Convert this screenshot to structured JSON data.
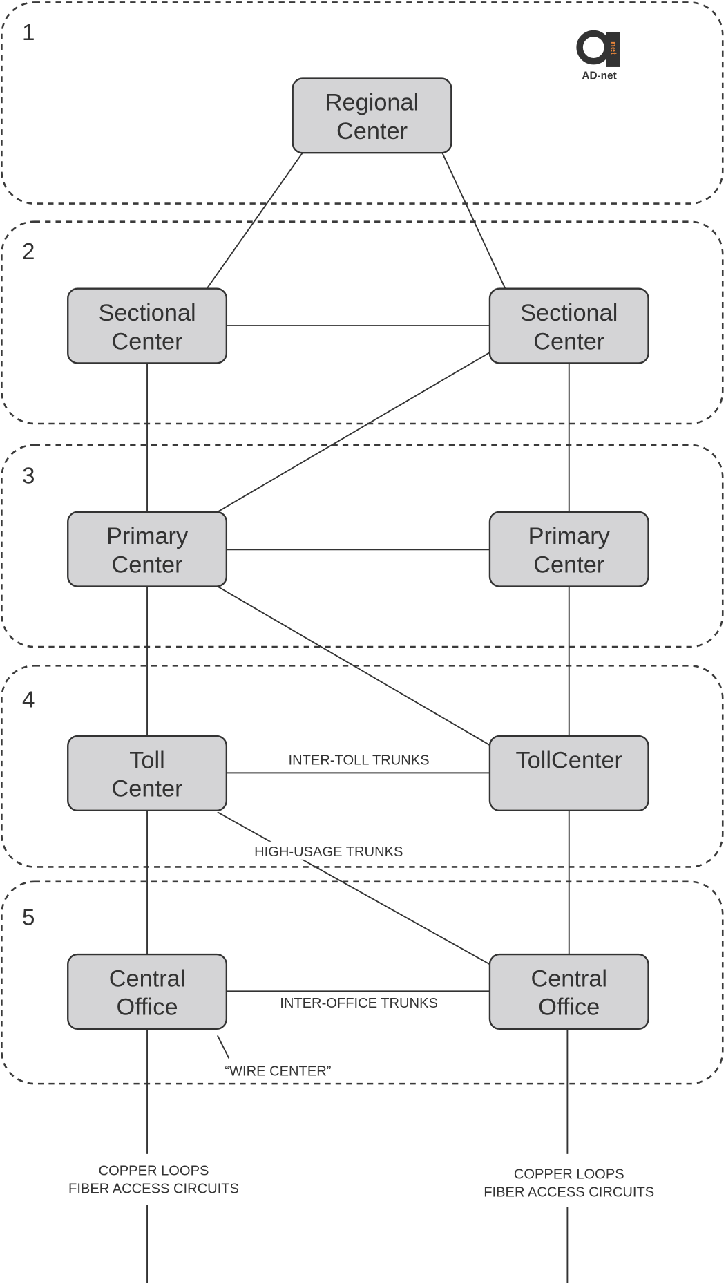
{
  "logo": {
    "text": "AD-net",
    "inner": "net",
    "accent": "#e8853a"
  },
  "levels": [
    "1",
    "2",
    "3",
    "4",
    "5"
  ],
  "nodes": {
    "regional": [
      "Regional",
      "Center"
    ],
    "sectional_left": [
      "Sectional",
      "Center"
    ],
    "sectional_right": [
      "Sectional",
      "Center"
    ],
    "primary_left": [
      "Primary",
      "Center"
    ],
    "primary_right": [
      "Primary",
      "Center"
    ],
    "toll_left": [
      "Toll",
      "Center"
    ],
    "toll_right": [
      "TollCenter"
    ],
    "central_left": [
      "Central",
      "Office"
    ],
    "central_right": [
      "Central",
      "Office"
    ]
  },
  "labels": {
    "inter_toll": "INTER-TOLL TRUNKS",
    "high_usage": "HIGH-USAGE TRUNKS",
    "inter_office": "INTER-OFFICE TRUNKS",
    "wire_center": "“WIRE CENTER”",
    "access_left": [
      "COPPER LOOPS",
      "FIBER ACCESS CIRCUITS"
    ],
    "access_right": [
      "COPPER LOOPS",
      "FIBER ACCESS CIRCUITS"
    ]
  },
  "colors": {
    "node_fill": "#d4d4d6",
    "stroke": "#333333"
  }
}
